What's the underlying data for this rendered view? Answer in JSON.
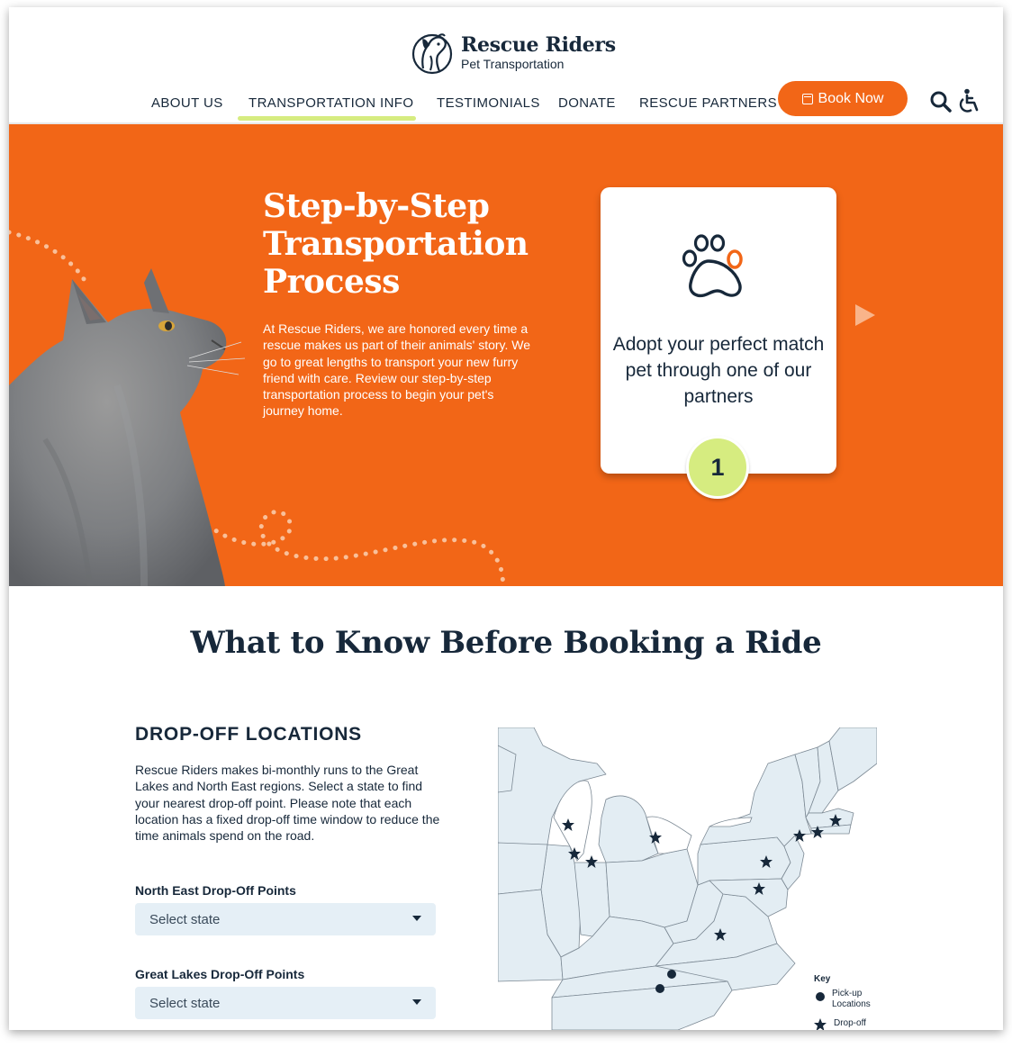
{
  "brand": {
    "name": "Rescue Riders",
    "tagline": "Pet Transportation"
  },
  "nav": {
    "items": [
      {
        "label": "ABOUT US"
      },
      {
        "label": "TRANSPORTATION INFO",
        "active": true
      },
      {
        "label": "TESTIMONIALS"
      },
      {
        "label": "DONATE"
      },
      {
        "label": "RESCUE PARTNERS"
      }
    ],
    "book_label": "Book Now",
    "icons": [
      "calendar-icon",
      "search-icon",
      "accessibility-icon"
    ]
  },
  "hero": {
    "title": "Step-by-Step Transportation Process",
    "body": "At Rescue Riders, we are honored every time a rescue makes us part of their animals' story. We go to great lengths to transport your new furry friend with care. Review our step-by-step transportation process to begin your pet's journey home.",
    "step": {
      "text": "Adopt your perfect match pet through one of our partners",
      "number": "1",
      "icon": "paw-icon"
    },
    "next_icon": "play-arrow-icon"
  },
  "section": {
    "title": "What to Know Before Booking a Ride"
  },
  "dropoff": {
    "heading": "DROP-OFF LOCATIONS",
    "body": "Rescue Riders makes bi-monthly runs to the Great Lakes and North East regions. Select a state to find your nearest drop-off point. Please note that each location has a fixed drop-off time window to reduce the time animals spend on the road.",
    "north_east_label": "North East Drop-Off Points",
    "north_east_value": "Select state",
    "great_lakes_label": "Great Lakes Drop-Off Points",
    "great_lakes_value": "Select state"
  },
  "map_key": {
    "title": "Key",
    "pickup": "Pick-up Locations",
    "dropoff": "Drop-off"
  },
  "colors": {
    "brand_orange": "#f26617",
    "accent_lime": "#d6ec80",
    "navy": "#17283a",
    "map_fill": "#e3edf3",
    "select_bg": "#e5eff6"
  }
}
